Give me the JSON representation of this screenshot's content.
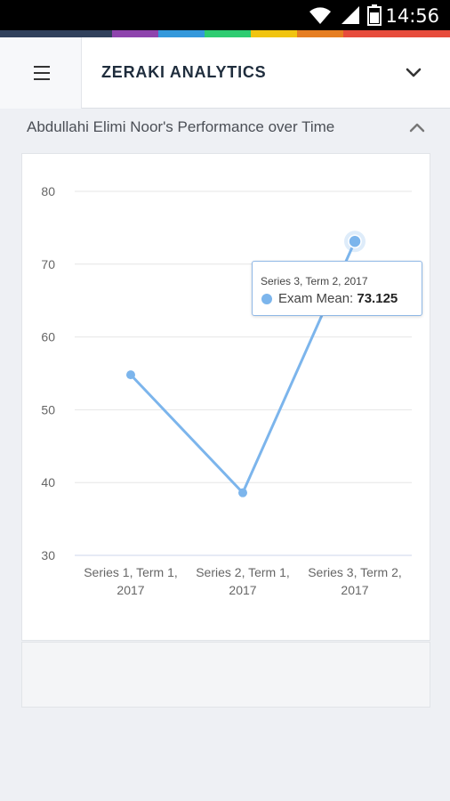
{
  "status_bar": {
    "time": "14:56"
  },
  "colors": {
    "accent": "#7cb5ec",
    "strip": [
      "#31415c",
      "#8e44ad",
      "#3498db",
      "#2ecc71",
      "#f1c40f",
      "#e67e22",
      "#e74c3c"
    ]
  },
  "app_bar": {
    "title": "ZERAKI ANALYTICS",
    "menu_icon": "hamburger-icon",
    "dropdown_icon": "chevron-down-icon"
  },
  "section": {
    "title": "Abdullahi Elimi Noor's Performance over Time",
    "collapse_icon": "chevron-up-icon"
  },
  "tooltip": {
    "header": "Series 3, Term 2, 2017",
    "label": "Exam Mean:",
    "value": "73.125"
  },
  "chart_data": {
    "type": "line",
    "categories": [
      "Series 1, Term 1, 2017",
      "Series 2, Term 1, 2017",
      "Series 3, Term 2, 2017"
    ],
    "category_lines": [
      [
        "Series 1, Term 1,",
        "2017"
      ],
      [
        "Series 2, Term 1,",
        "2017"
      ],
      [
        "Series 3, Term 2,",
        "2017"
      ]
    ],
    "series": [
      {
        "name": "Exam Mean",
        "values": [
          54.8,
          38.6,
          73.125
        ]
      }
    ],
    "ylim": [
      30,
      80
    ],
    "yticks": [
      "30",
      "40",
      "50",
      "60",
      "70",
      "80"
    ],
    "grid": true,
    "highlighted_index": 2
  }
}
